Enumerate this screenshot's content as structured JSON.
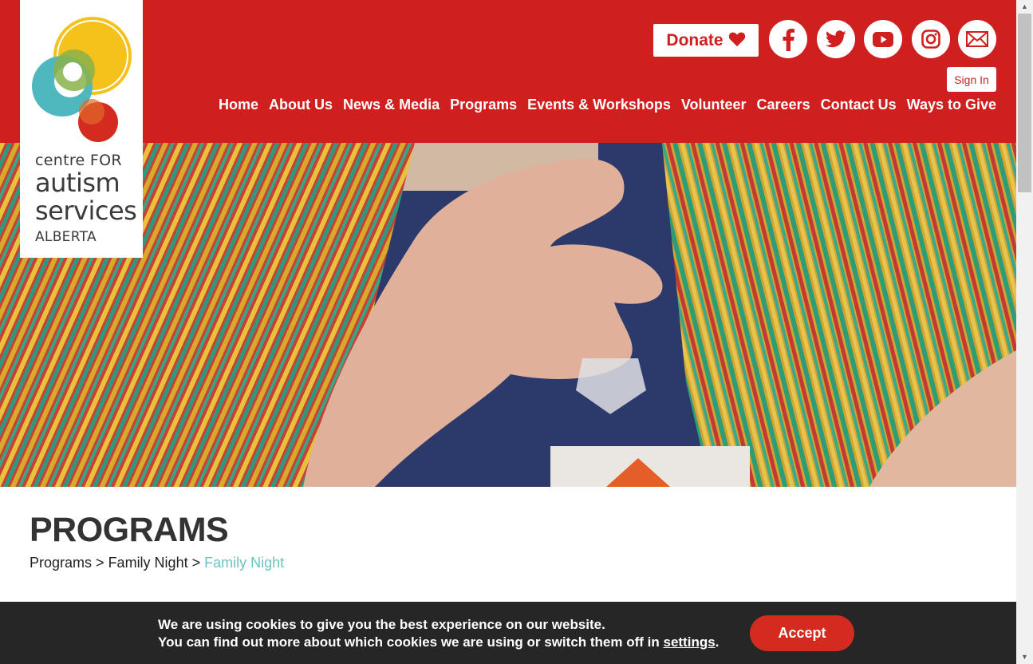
{
  "logo": {
    "line1": "centre FOR",
    "line2": "autism",
    "line3": "services",
    "line4": "ALBERTA"
  },
  "header": {
    "donate_label": "Donate",
    "donate_icon": "heart-icon",
    "social": [
      {
        "name": "facebook-icon",
        "glyph": "f"
      },
      {
        "name": "twitter-icon"
      },
      {
        "name": "youtube-icon"
      },
      {
        "name": "instagram-icon"
      },
      {
        "name": "mail-icon"
      }
    ],
    "signin_label": "Sign In",
    "nav": [
      "Home",
      "About Us",
      "News & Media",
      "Programs",
      "Events & Workshops",
      "Volunteer",
      "Careers",
      "Contact Us",
      "Ways to Give"
    ]
  },
  "page": {
    "title": "PROGRAMS",
    "breadcrumb": [
      "Programs",
      "Family Night",
      "Family Night"
    ],
    "separator": ">"
  },
  "cookie": {
    "line1": "We are using cookies to give you the best experience on our website.",
    "line2_pre": "You can find out more about which cookies we are using or switch them off in ",
    "settings_link": "settings",
    "line2_post": ".",
    "accept_label": "Accept"
  },
  "colors": {
    "brand_red": "#cf1f1f",
    "teal_link": "#6cc3c4",
    "cookie_bg": "#262626"
  }
}
